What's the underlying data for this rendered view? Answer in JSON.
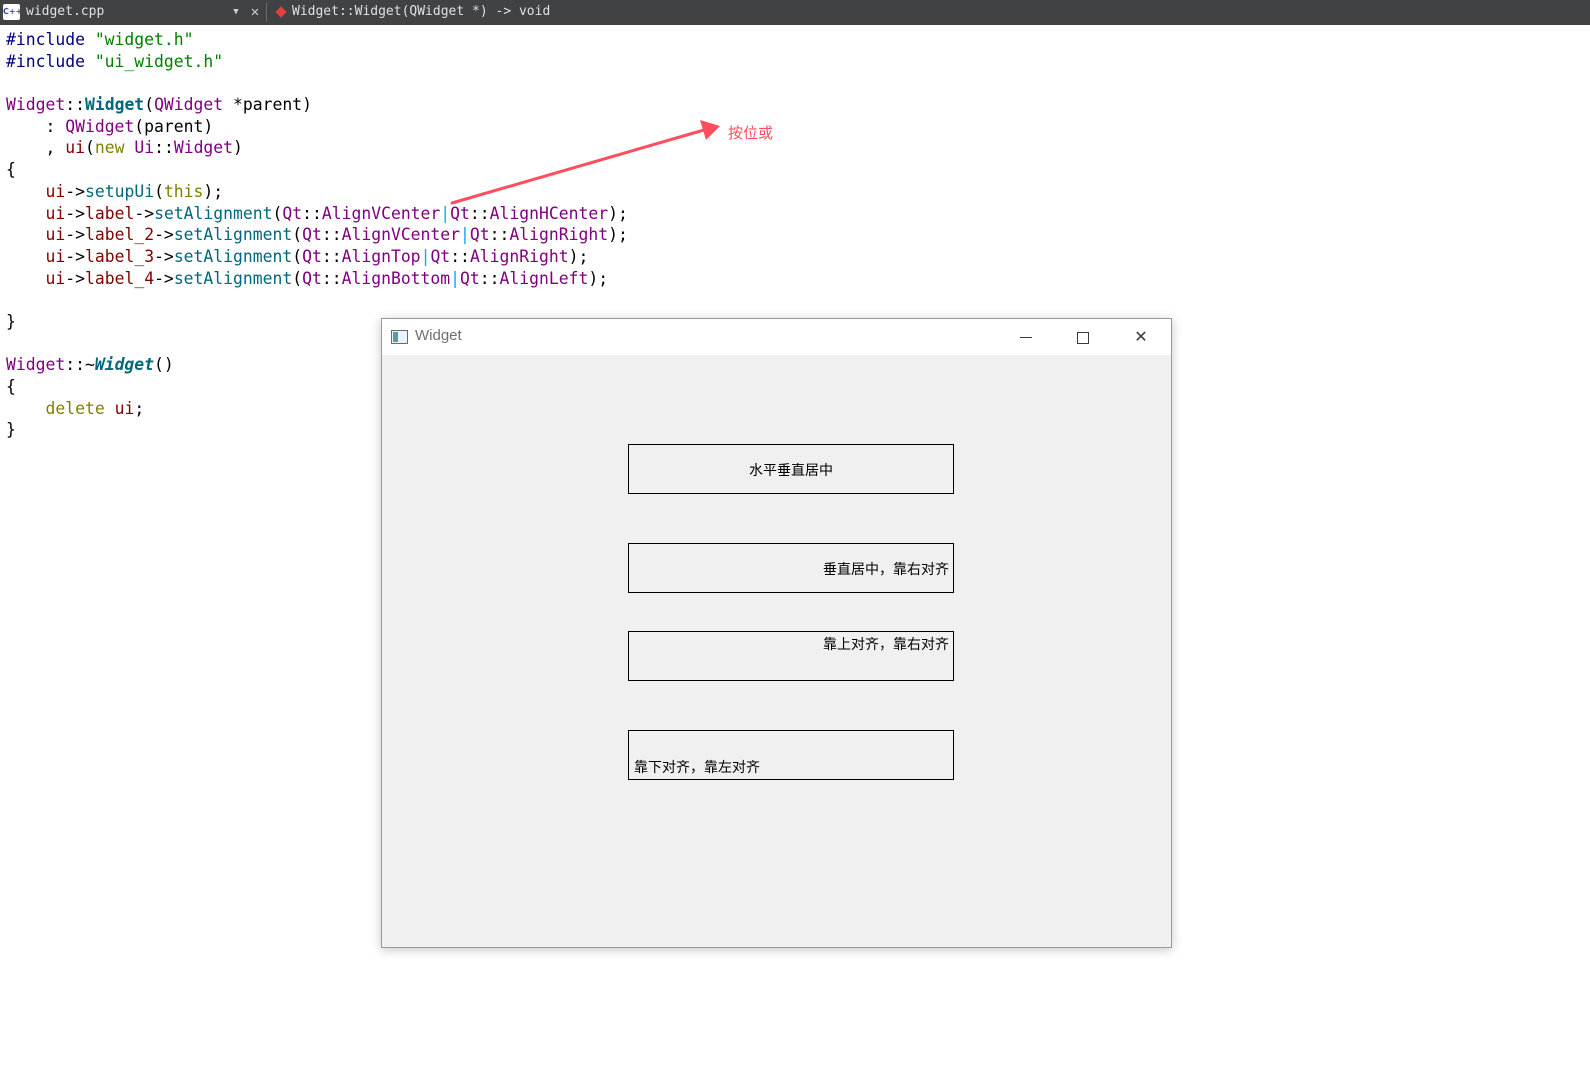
{
  "tabbar": {
    "icon_text": "C++",
    "file_name": "widget.cpp",
    "function": "Widget::Widget(QWidget *) -> void"
  },
  "code": {
    "lines": [
      [
        {
          "t": "#include ",
          "k": "pp"
        },
        {
          "t": "\"widget.h\"",
          "k": "str"
        }
      ],
      [
        {
          "t": "#include ",
          "k": "pp"
        },
        {
          "t": "\"ui_widget.h\"",
          "k": "str"
        }
      ],
      [],
      [
        {
          "t": "Widget",
          "k": "cls"
        },
        {
          "t": "::",
          "k": "plain"
        },
        {
          "t": "Widget",
          "k": "func-def"
        },
        {
          "t": "(",
          "k": "plain"
        },
        {
          "t": "QWidget",
          "k": "cls"
        },
        {
          "t": " *parent)",
          "k": "plain"
        }
      ],
      [
        {
          "t": "    : ",
          "k": "plain"
        },
        {
          "t": "QWidget",
          "k": "cls"
        },
        {
          "t": "(parent)",
          "k": "plain"
        }
      ],
      [
        {
          "t": "    , ",
          "k": "plain"
        },
        {
          "t": "ui",
          "k": "mem"
        },
        {
          "t": "(",
          "k": "plain"
        },
        {
          "t": "new",
          "k": "kw"
        },
        {
          "t": " ",
          "k": "plain"
        },
        {
          "t": "Ui",
          "k": "cls"
        },
        {
          "t": "::",
          "k": "plain"
        },
        {
          "t": "Widget",
          "k": "cls"
        },
        {
          "t": ")",
          "k": "plain"
        }
      ],
      [
        {
          "t": "{",
          "k": "plain"
        }
      ],
      [
        {
          "t": "    ",
          "k": "plain"
        },
        {
          "t": "ui",
          "k": "mem"
        },
        {
          "t": "->",
          "k": "plain"
        },
        {
          "t": "setupUi",
          "k": "call"
        },
        {
          "t": "(",
          "k": "plain"
        },
        {
          "t": "this",
          "k": "kw"
        },
        {
          "t": ");",
          "k": "plain"
        }
      ],
      [
        {
          "t": "    ",
          "k": "plain"
        },
        {
          "t": "ui",
          "k": "mem"
        },
        {
          "t": "->",
          "k": "plain"
        },
        {
          "t": "label",
          "k": "mem"
        },
        {
          "t": "->",
          "k": "plain"
        },
        {
          "t": "setAlignment",
          "k": "call"
        },
        {
          "t": "(",
          "k": "plain"
        },
        {
          "t": "Qt",
          "k": "cls"
        },
        {
          "t": "::",
          "k": "plain"
        },
        {
          "t": "AlignVCenter",
          "k": "cls"
        },
        {
          "t": "|",
          "k": "sep"
        },
        {
          "t": "Qt",
          "k": "cls"
        },
        {
          "t": "::",
          "k": "plain"
        },
        {
          "t": "AlignHCenter",
          "k": "cls"
        },
        {
          "t": ");",
          "k": "plain"
        }
      ],
      [
        {
          "t": "    ",
          "k": "plain"
        },
        {
          "t": "ui",
          "k": "mem"
        },
        {
          "t": "->",
          "k": "plain"
        },
        {
          "t": "label_2",
          "k": "mem"
        },
        {
          "t": "->",
          "k": "plain"
        },
        {
          "t": "setAlignment",
          "k": "call"
        },
        {
          "t": "(",
          "k": "plain"
        },
        {
          "t": "Qt",
          "k": "cls"
        },
        {
          "t": "::",
          "k": "plain"
        },
        {
          "t": "AlignVCenter",
          "k": "cls"
        },
        {
          "t": "|",
          "k": "sep"
        },
        {
          "t": "Qt",
          "k": "cls"
        },
        {
          "t": "::",
          "k": "plain"
        },
        {
          "t": "AlignRight",
          "k": "cls"
        },
        {
          "t": ");",
          "k": "plain"
        }
      ],
      [
        {
          "t": "    ",
          "k": "plain"
        },
        {
          "t": "ui",
          "k": "mem"
        },
        {
          "t": "->",
          "k": "plain"
        },
        {
          "t": "label_3",
          "k": "mem"
        },
        {
          "t": "->",
          "k": "plain"
        },
        {
          "t": "setAlignment",
          "k": "call"
        },
        {
          "t": "(",
          "k": "plain"
        },
        {
          "t": "Qt",
          "k": "cls"
        },
        {
          "t": "::",
          "k": "plain"
        },
        {
          "t": "AlignTop",
          "k": "cls"
        },
        {
          "t": "|",
          "k": "sep"
        },
        {
          "t": "Qt",
          "k": "cls"
        },
        {
          "t": "::",
          "k": "plain"
        },
        {
          "t": "AlignRight",
          "k": "cls"
        },
        {
          "t": ");",
          "k": "plain"
        }
      ],
      [
        {
          "t": "    ",
          "k": "plain"
        },
        {
          "t": "ui",
          "k": "mem"
        },
        {
          "t": "->",
          "k": "plain"
        },
        {
          "t": "label_4",
          "k": "mem"
        },
        {
          "t": "->",
          "k": "plain"
        },
        {
          "t": "setAlignment",
          "k": "call"
        },
        {
          "t": "(",
          "k": "plain"
        },
        {
          "t": "Qt",
          "k": "cls"
        },
        {
          "t": "::",
          "k": "plain"
        },
        {
          "t": "AlignBottom",
          "k": "cls"
        },
        {
          "t": "|",
          "k": "sep"
        },
        {
          "t": "Qt",
          "k": "cls"
        },
        {
          "t": "::",
          "k": "plain"
        },
        {
          "t": "AlignLeft",
          "k": "cls"
        },
        {
          "t": ");",
          "k": "plain"
        }
      ],
      [],
      [
        {
          "t": "}",
          "k": "plain"
        }
      ],
      [],
      [
        {
          "t": "Widget",
          "k": "cls"
        },
        {
          "t": "::~",
          "k": "plain"
        },
        {
          "t": "Widget",
          "k": "func-def-i"
        },
        {
          "t": "()",
          "k": "plain"
        }
      ],
      [
        {
          "t": "{",
          "k": "plain"
        }
      ],
      [
        {
          "t": "    ",
          "k": "plain"
        },
        {
          "t": "delete",
          "k": "kw"
        },
        {
          "t": " ",
          "k": "plain"
        },
        {
          "t": "ui",
          "k": "mem"
        },
        {
          "t": ";",
          "k": "plain"
        }
      ],
      [
        {
          "t": "}",
          "k": "plain"
        }
      ]
    ]
  },
  "annotation": {
    "text": "按位或",
    "color": "#ff4f5e"
  },
  "window": {
    "title": "Widget",
    "labels": {
      "label_1": "水平垂直居中",
      "label_2": "垂直居中，靠右对齐",
      "label_3": "靠上对齐，靠右对齐",
      "label_4": "靠下对齐，靠左对齐"
    }
  },
  "icons": {
    "tab_file": "cpp-file-icon",
    "tab_dropdown": "dropdown-arrow-icon",
    "tab_close": "close-icon",
    "tab_function": "function-icon",
    "window_app": "window-app-icon",
    "minimize": "minimize-icon",
    "maximize": "maximize-icon",
    "close": "close-icon"
  }
}
